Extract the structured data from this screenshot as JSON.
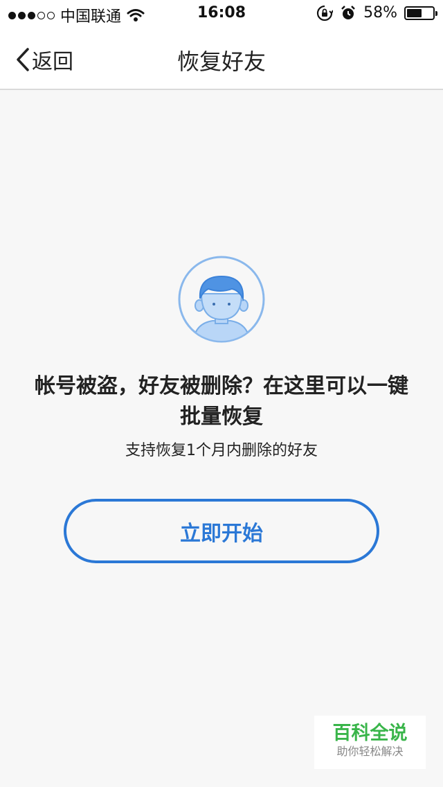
{
  "status_bar": {
    "signal_full": 3,
    "signal_total": 5,
    "carrier": "中国联通",
    "time": "16:08",
    "battery_percent_text": "58%",
    "battery_level": 0.58
  },
  "nav": {
    "back_label": "返回",
    "title": "恢复好友"
  },
  "main": {
    "headline_line1": "帐号被盗，好友被删除？在这里可以一键",
    "headline_line2": "批量恢复",
    "subtext": "支持恢复1个月内删除的好友",
    "start_button_label": "立即开始"
  },
  "watermark": {
    "title": "百科全说",
    "subtitle": "助你轻松解决"
  },
  "colors": {
    "accent": "#2b78d6",
    "avatar_light": "#a9cdf5",
    "watermark_green": "#39b54a",
    "background": "#f7f7f7"
  }
}
